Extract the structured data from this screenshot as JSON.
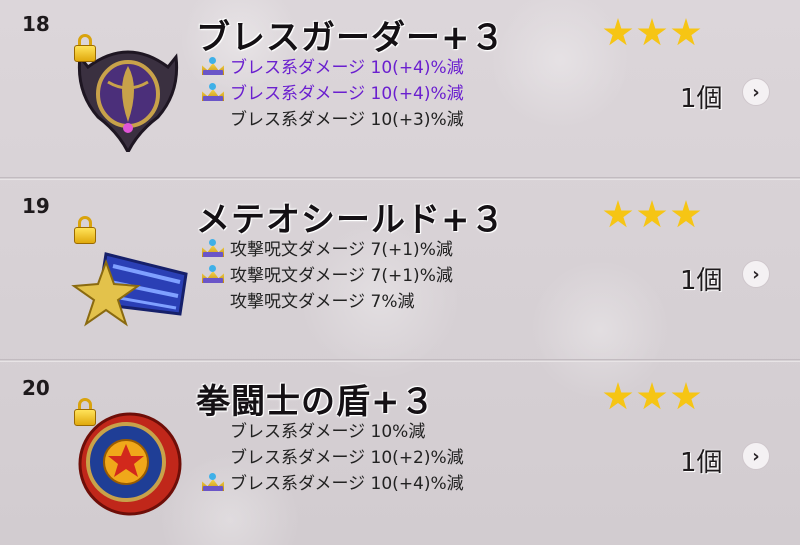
{
  "rows": [
    {
      "number": "18",
      "name": "ブレスガーダー+３",
      "stars": 3,
      "effects": [
        {
          "text": "ブレス系ダメージ 10(+4)%減",
          "crown": true,
          "highlight": true
        },
        {
          "text": "ブレス系ダメージ 10(+4)%減",
          "crown": true,
          "highlight": true
        },
        {
          "text": "ブレス系ダメージ 10(+3)%減",
          "crown": false,
          "highlight": false
        }
      ],
      "count": "1個",
      "icon": "breath-guarder-shield-icon"
    },
    {
      "number": "19",
      "name": "メテオシールド+３",
      "stars": 3,
      "effects": [
        {
          "text": "攻撃呪文ダメージ 7(+1)%減",
          "crown": true,
          "highlight": false
        },
        {
          "text": "攻撃呪文ダメージ 7(+1)%減",
          "crown": true,
          "highlight": false
        },
        {
          "text": "攻撃呪文ダメージ 7%減",
          "crown": false,
          "highlight": false
        }
      ],
      "count": "1個",
      "icon": "meteor-shield-icon"
    },
    {
      "number": "20",
      "name": "拳闘士の盾+３",
      "stars": 3,
      "effects": [
        {
          "text": "ブレス系ダメージ 10%減",
          "crown": false,
          "highlight": false
        },
        {
          "text": "ブレス系ダメージ 10(+2)%減",
          "crown": false,
          "highlight": false
        },
        {
          "text": "ブレス系ダメージ 10(+4)%減",
          "crown": true,
          "highlight": false
        }
      ],
      "count": "1個",
      "icon": "boxer-shield-icon"
    }
  ],
  "colors": {
    "highlight_text": "#6a1fcf",
    "star": "#f6c514",
    "lock": "#e0a90d"
  },
  "icons": {
    "lock": "lock-icon",
    "crown": "crown-icon",
    "star": "star-icon",
    "chevron": "chevron-right-icon"
  }
}
